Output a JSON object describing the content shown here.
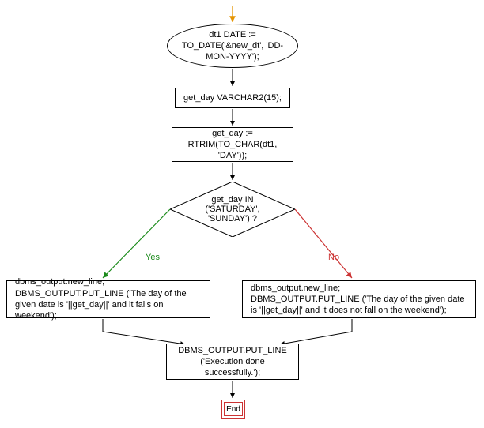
{
  "nodes": {
    "start": "dt1 DATE := TO_DATE('&new_dt', 'DD-MON-YYYY');",
    "decl": "get_day VARCHAR2(15);",
    "assign": "get_day := RTRIM(TO_CHAR(dt1, 'DAY'));",
    "cond": "get_day IN ('SATURDAY', 'SUNDAY') ?",
    "yes_block": "dbms_output.new_line;\nDBMS_OUTPUT.PUT_LINE ('The day of the given date is '||get_day||' and it falls on weekend');",
    "no_block": "dbms_output.new_line;\nDBMS_OUTPUT.PUT_LINE ('The day of the given date is '||get_day||' and it does not fall on the weekend');",
    "done": "DBMS_OUTPUT.PUT_LINE ('Execution  done successfully.');",
    "end": "End"
  },
  "edges": {
    "yes": "Yes",
    "no": "No"
  }
}
